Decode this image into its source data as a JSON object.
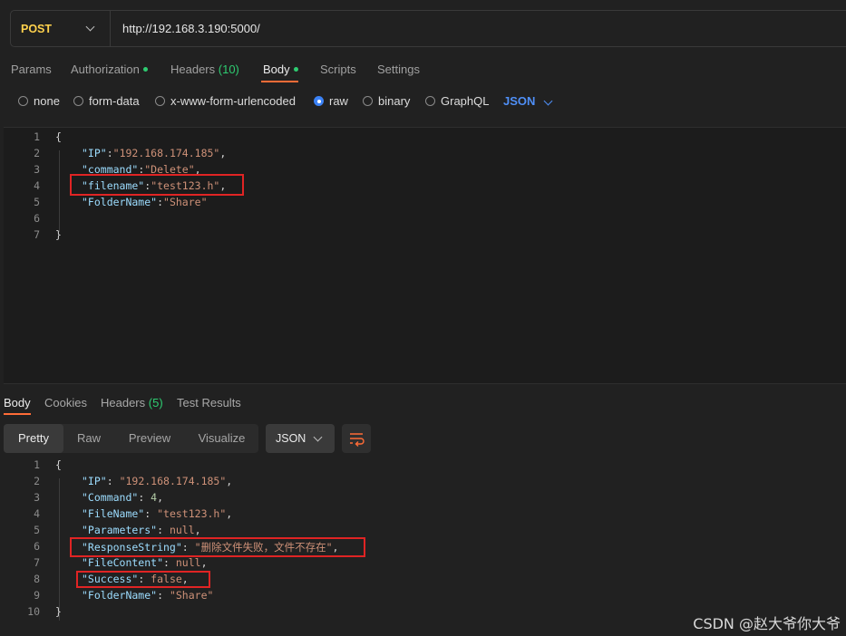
{
  "request": {
    "method": "POST",
    "url": "http://192.168.3.190:5000/",
    "tabs": [
      {
        "label": "Params",
        "active": false
      },
      {
        "label": "Authorization",
        "active": false,
        "dot": true
      },
      {
        "label": "Headers",
        "count": "(10)",
        "active": false
      },
      {
        "label": "Body",
        "active": true,
        "dot": true
      },
      {
        "label": "Scripts",
        "active": false
      },
      {
        "label": "Settings",
        "active": false
      }
    ],
    "body_types": [
      "none",
      "form-data",
      "x-www-form-urlencoded",
      "raw",
      "binary",
      "GraphQL"
    ],
    "selected_body_type": "raw",
    "format": "JSON",
    "body_lines": [
      {
        "n": "1",
        "text": "{"
      },
      {
        "n": "2",
        "key": "\"IP\"",
        "value": "\"192.168.174.185\"",
        "tail": ","
      },
      {
        "n": "3",
        "key": "\"command\"",
        "value": "\"Delete\"",
        "tail": ","
      },
      {
        "n": "4",
        "key": "\"filename\"",
        "value": "\"test123.h\"",
        "tail": ","
      },
      {
        "n": "5",
        "key": "\"FolderName\"",
        "value": "\"Share\"",
        "tail": ""
      },
      {
        "n": "6",
        "text": ""
      },
      {
        "n": "7",
        "text": "}"
      }
    ]
  },
  "response": {
    "tabs": [
      {
        "label": "Body",
        "active": true
      },
      {
        "label": "Cookies",
        "active": false
      },
      {
        "label": "Headers",
        "count": "(5)",
        "active": false
      },
      {
        "label": "Test Results",
        "active": false
      }
    ],
    "view_modes": [
      "Pretty",
      "Raw",
      "Preview",
      "Visualize"
    ],
    "selected_view": "Pretty",
    "format": "JSON",
    "lines": [
      {
        "n": "1",
        "text": "{"
      },
      {
        "n": "2",
        "key": "\"IP\"",
        "value": "\"192.168.174.185\"",
        "tail": ","
      },
      {
        "n": "3",
        "key": "\"Command\"",
        "value": "4",
        "tail": ","
      },
      {
        "n": "4",
        "key": "\"FileName\"",
        "value": "\"test123.h\"",
        "tail": ","
      },
      {
        "n": "5",
        "key": "\"Parameters\"",
        "value": "null",
        "tail": ","
      },
      {
        "n": "6",
        "key": "\"ResponseString\"",
        "value": "\"删除文件失败，文件不存在\"",
        "tail": ","
      },
      {
        "n": "7",
        "key": "\"FileContent\"",
        "value": "null",
        "tail": ","
      },
      {
        "n": "8",
        "key": "\"Success\"",
        "value": "false",
        "tail": ","
      },
      {
        "n": "9",
        "key": "\"FolderName\"",
        "value": "\"Share\"",
        "tail": ""
      },
      {
        "n": "10",
        "text": "}"
      }
    ]
  },
  "watermark": "CSDN @赵大爷你大爷",
  "colors": {
    "accent": "#ff6c37",
    "highlight_box": "#e02424",
    "method": "#ffd24d",
    "json": "#4f8ff7"
  }
}
